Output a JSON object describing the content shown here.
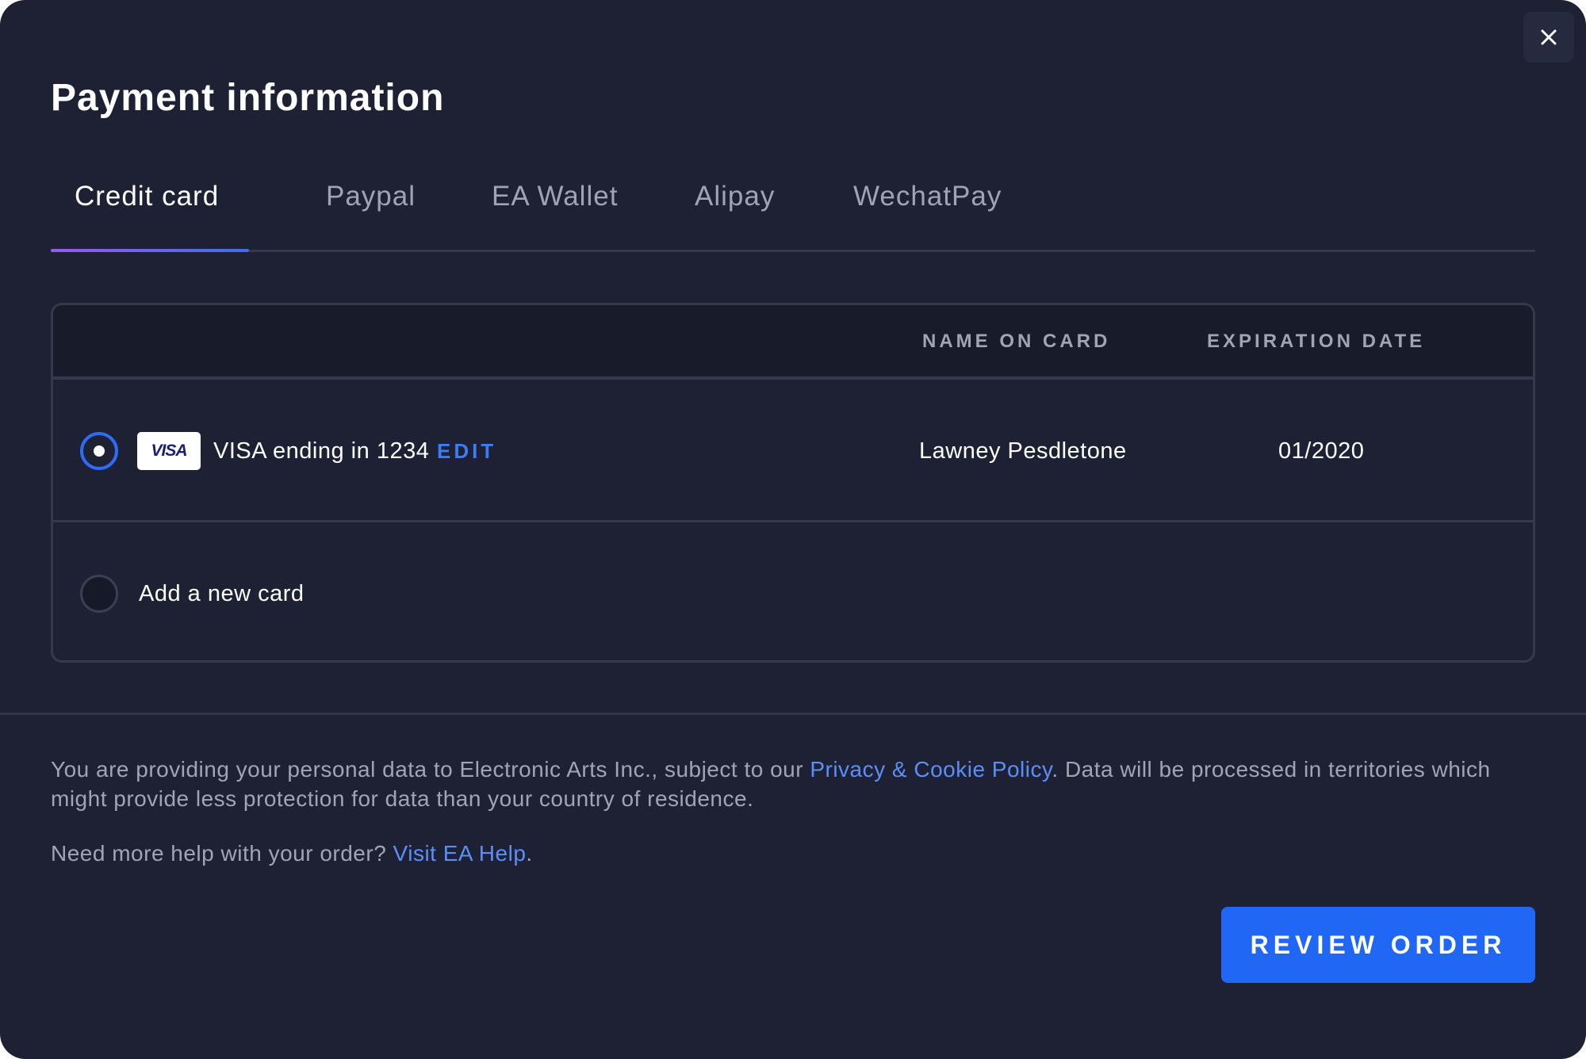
{
  "modal": {
    "title": "Payment information",
    "close_icon": "close-icon"
  },
  "tabs": [
    {
      "label": "Credit card",
      "active": true
    },
    {
      "label": "Paypal",
      "active": false
    },
    {
      "label": "EA Wallet",
      "active": false
    },
    {
      "label": "Alipay",
      "active": false
    },
    {
      "label": "WechatPay",
      "active": false
    }
  ],
  "card_table": {
    "headers": {
      "name_on_card": "NAME ON CARD",
      "expiration_date": "EXPIRATION DATE"
    },
    "saved_card": {
      "brand": "VISA",
      "description": "VISA ending in 1234",
      "edit_label": "EDIT",
      "name_on_card": "Lawney Pesdletone",
      "expiration": "01/2020",
      "selected": true
    },
    "add_card": {
      "label": "Add a new card",
      "selected": false
    }
  },
  "footer": {
    "privacy_text_1": "You are providing your personal data to Electronic Arts Inc., subject to our ",
    "privacy_link": "Privacy & Cookie Policy",
    "privacy_text_2": ". Data will be processed in territories which might provide less protection for data than your country of residence.",
    "help_text": "Need more help with your order? ",
    "help_link": "Visit EA Help",
    "help_end": "."
  },
  "actions": {
    "review_order_label": "REVIEW ORDER"
  },
  "colors": {
    "background": "#1e2134",
    "accent": "#2167f5",
    "link": "#5b8ff7",
    "tab_indicator_start": "#9b59f5",
    "tab_indicator_end": "#3f6df2"
  }
}
